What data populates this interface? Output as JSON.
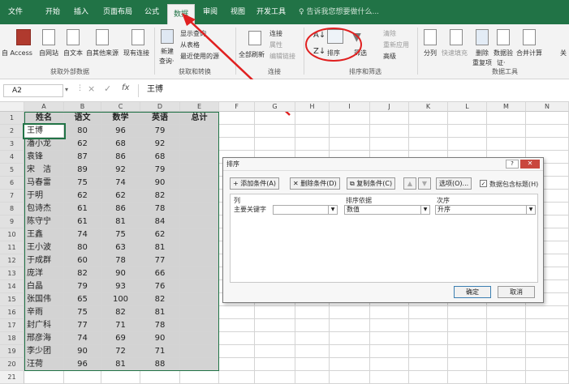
{
  "tabs": [
    "文件",
    "开始",
    "插入",
    "页面布局",
    "公式",
    "数据",
    "审阅",
    "视图",
    "开发工具"
  ],
  "tell_me": "告诉我您想要做什么...",
  "ribbon": {
    "access": "自 Access",
    "web": "自网站",
    "text": "自文本",
    "other": "自其他来源",
    "existing": "现有连接",
    "new_query": "新建",
    "new_query2": "查询·",
    "show_query": "显示查询",
    "from_table": "从表格",
    "recent": "最近使用的源",
    "refresh_all": "全部刷新",
    "connections": "连接",
    "properties": "属性",
    "edit_links": "编辑链接",
    "sort": "排序",
    "filter": "筛选",
    "clear": "清除",
    "reapply": "重新应用",
    "advanced": "高级",
    "split": "分列",
    "flash": "快速填充",
    "remove_dup": "删除",
    "remove_dup2": "重复项",
    "validate": "数据验",
    "validate2": "证·",
    "consolidate": "合并计算",
    "relations": "关",
    "groups": {
      "external": "获取外部数据",
      "transform": "获取和转换",
      "conn": "连接",
      "sortfilter": "排序和筛选",
      "tools": "数据工具"
    }
  },
  "name_box": "A2",
  "formula": "王博",
  "columns": [
    "A",
    "B",
    "C",
    "D",
    "E",
    "F",
    "G",
    "H",
    "I",
    "J",
    "K",
    "L",
    "M",
    "N"
  ],
  "header_row": [
    "姓名",
    "语文",
    "数学",
    "英语",
    "总计"
  ],
  "rows": [
    [
      "王博",
      "80",
      "96",
      "79"
    ],
    [
      "潘小龙",
      "62",
      "68",
      "92"
    ],
    [
      "袁锋",
      "87",
      "86",
      "68"
    ],
    [
      "宋　洁",
      "89",
      "92",
      "79"
    ],
    [
      "马春雷",
      "75",
      "74",
      "90"
    ],
    [
      "于明",
      "62",
      "62",
      "82"
    ],
    [
      "包诗杰",
      "61",
      "86",
      "78"
    ],
    [
      "陈守宁",
      "61",
      "81",
      "84"
    ],
    [
      "王鑫",
      "74",
      "75",
      "62"
    ],
    [
      "王小波",
      "80",
      "63",
      "81"
    ],
    [
      "于成群",
      "60",
      "78",
      "77"
    ],
    [
      "庞洋",
      "82",
      "90",
      "66"
    ],
    [
      "白晶",
      "79",
      "93",
      "76"
    ],
    [
      "张国伟",
      "65",
      "100",
      "82"
    ],
    [
      "辛雨",
      "75",
      "82",
      "81"
    ],
    [
      "封广科",
      "77",
      "71",
      "78"
    ],
    [
      "邢彦海",
      "74",
      "69",
      "90"
    ],
    [
      "李少团",
      "90",
      "72",
      "71"
    ],
    [
      "汪荷",
      "96",
      "81",
      "88"
    ]
  ],
  "row_numbers": [
    "1",
    "2",
    "3",
    "4",
    "5",
    "6",
    "7",
    "8",
    "9",
    "10",
    "11",
    "12",
    "13",
    "14",
    "15",
    "16",
    "17",
    "18",
    "19",
    "20",
    "21"
  ],
  "dialog": {
    "title": "排序",
    "add": "添加条件(A)",
    "delete": "删除条件(D)",
    "copy": "复制条件(C)",
    "options": "选项(O)...",
    "has_header": "数据包含标题(H)",
    "col_header": "列",
    "basis_header": "排序依据",
    "order_header": "次序",
    "primary": "主要关键字",
    "primary_value": "",
    "basis_value": "数值",
    "order_value": "升序",
    "ok": "确定",
    "cancel": "取消"
  },
  "accent": "#217346"
}
